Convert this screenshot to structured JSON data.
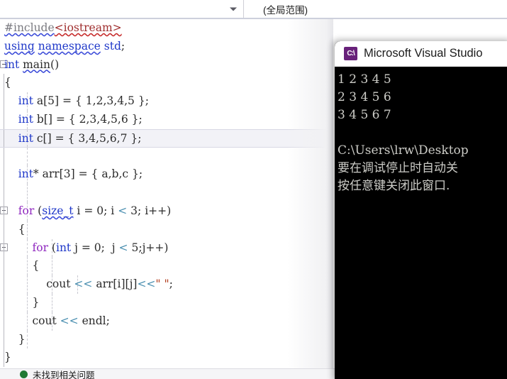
{
  "navbar": {
    "scope_combo": {
      "name": "member-scope-dropdown",
      "value": "",
      "arrow_icon": "chevron-down-icon"
    },
    "global_combo": {
      "name": "global-scope-dropdown",
      "value": "(全局范围)"
    }
  },
  "editor": {
    "language": "cpp",
    "current_line_index": 6,
    "lines": [
      {
        "n": 0,
        "fold": false,
        "text": "#include<iostream>"
      },
      {
        "n": 1,
        "fold": false,
        "text": "using namespace std;"
      },
      {
        "n": 2,
        "fold": true,
        "text": "int main()"
      },
      {
        "n": 3,
        "fold": false,
        "text": "{"
      },
      {
        "n": 4,
        "fold": false,
        "text": "    int a[5] = { 1,2,3,4,5 };"
      },
      {
        "n": 5,
        "fold": false,
        "text": "    int b[] = { 2,3,4,5,6 };"
      },
      {
        "n": 6,
        "fold": false,
        "text": "    int c[] = { 3,4,5,6,7 };"
      },
      {
        "n": 7,
        "fold": false,
        "text": ""
      },
      {
        "n": 8,
        "fold": false,
        "text": "    int* arr[3] = { a,b,c };"
      },
      {
        "n": 9,
        "fold": false,
        "text": ""
      },
      {
        "n": 10,
        "fold": true,
        "text": "    for (size_t i = 0; i < 3; i++)"
      },
      {
        "n": 11,
        "fold": false,
        "text": "    {"
      },
      {
        "n": 12,
        "fold": true,
        "text": "        for (int j = 0;  j < 5;j++)"
      },
      {
        "n": 13,
        "fold": false,
        "text": "        {"
      },
      {
        "n": 14,
        "fold": false,
        "text": "            cout << arr[i][j]<<\" \";"
      },
      {
        "n": 15,
        "fold": false,
        "text": "        }"
      },
      {
        "n": 16,
        "fold": false,
        "text": "        cout << endl;"
      },
      {
        "n": 17,
        "fold": false,
        "text": "    }"
      },
      {
        "n": 18,
        "fold": false,
        "text": "}"
      }
    ]
  },
  "console": {
    "title": "Microsoft Visual Studio",
    "icon": "console-cmd-icon",
    "icon_glyph": "C:\\",
    "output_lines": [
      "1 2 3 4 5",
      "2 3 4 5 6",
      "3 4 5 6 7",
      "",
      "C:\\Users\\lrw\\Desktop",
      "要在调试停止时自动关",
      "按任意键关闭此窗口."
    ]
  },
  "status_bar": {
    "icon": "status-ready-icon",
    "text": "未找到相关问题"
  },
  "colors": {
    "keyword": "#1f38c9",
    "control_keyword": "#8f27bf",
    "preprocessor": "#7a7a80",
    "include_path": "#a03030",
    "string": "#b03a1a",
    "operator": "#4a8fb0",
    "plain": "#2b2b2b",
    "current_line_bg": "#f2f2f7",
    "console_bg": "#000000",
    "console_fg": "#ccccc7",
    "vs_purple": "#68217a"
  }
}
